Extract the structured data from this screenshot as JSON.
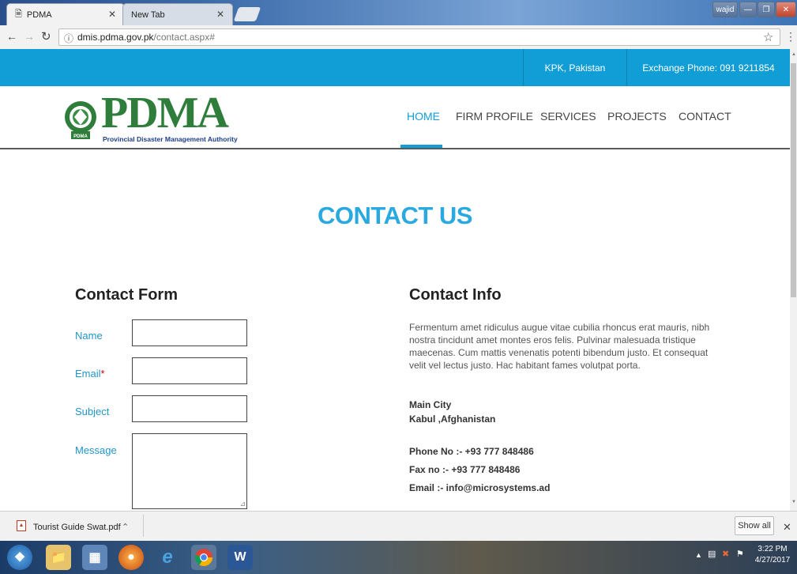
{
  "browser": {
    "tabs": [
      {
        "title": "PDMA"
      },
      {
        "title": "New Tab"
      }
    ],
    "user_badge": "wajid",
    "url_host": "dmis.pdma.gov.pk",
    "url_path": "/contact.aspx#"
  },
  "site": {
    "top_strip": {
      "location": "KPK, Pakistan",
      "exchange_phone": "Exchange Phone: 091 9211854"
    },
    "logo": {
      "brand": "PDMA",
      "tagline": "Provincial Disaster Management Authority"
    },
    "nav": [
      "HOME",
      "FIRM PROFILE",
      "SERVICES",
      "PROJECTS",
      "CONTACT"
    ],
    "accent_color": "#119ed6"
  },
  "page": {
    "title": "CONTACT US",
    "form": {
      "heading": "Contact Form",
      "name_label": "Name",
      "email_label": "Email",
      "email_required_mark": "*",
      "subject_label": "Subject",
      "message_label": "Message"
    },
    "info": {
      "heading": "Contact Info",
      "description": "Fermentum amet ridiculus augue vitae cubilia rhoncus erat mauris, nibh nostra tincidunt amet montes eros felis. Pulvinar malesuada tristique maecenas. Cum mattis venenatis potenti bibendum justo. Et consequat velit vel lectus justo. Hac habitant fames volutpat porta.",
      "city": "Main City",
      "address": "Kabul ,Afghanistan",
      "phone": "Phone No :- +93 777 848486",
      "fax": "Fax no :- +93 777 848486",
      "email": "Email :- info@microsystems.ad"
    }
  },
  "downloads": {
    "file": "Tourist Guide Swat.pdf",
    "show_all": "Show all"
  },
  "taskbar": {
    "time": "3:22 PM",
    "date": "4/27/2017"
  }
}
